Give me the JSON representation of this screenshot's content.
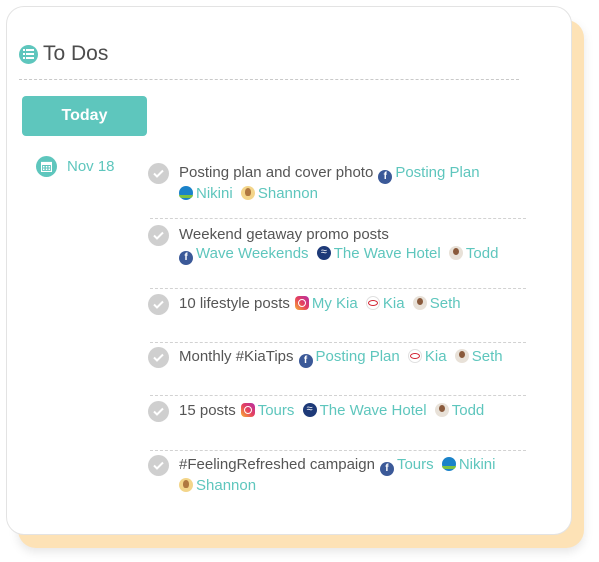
{
  "header": {
    "title": "To Dos",
    "icon": "list-icon"
  },
  "today_button": "Today",
  "date_group": {
    "icon": "calendar-icon",
    "label": "Nov 18"
  },
  "todos": [
    {
      "title": "Posting plan and cover photo",
      "tags": [
        {
          "icon": "facebook-icon",
          "label": "Posting Plan"
        },
        {
          "icon": "nikini-logo-icon",
          "label": "Nikini"
        },
        {
          "icon": "avatar-shannon-icon",
          "label": "Shannon"
        }
      ]
    },
    {
      "title": "Weekend getaway promo posts",
      "tags": [
        {
          "icon": "facebook-icon",
          "label": "Wave Weekends"
        },
        {
          "icon": "wave-hotel-logo-icon",
          "label": "The Wave Hotel"
        },
        {
          "icon": "avatar-todd-icon",
          "label": "Todd"
        }
      ]
    },
    {
      "title": "10 lifestyle posts",
      "tags": [
        {
          "icon": "instagram-icon",
          "label": "My Kia"
        },
        {
          "icon": "kia-logo-icon",
          "label": "Kia"
        },
        {
          "icon": "avatar-seth-icon",
          "label": "Seth"
        }
      ]
    },
    {
      "title": "Monthly #KiaTips",
      "tags": [
        {
          "icon": "facebook-icon",
          "label": "Posting Plan"
        },
        {
          "icon": "kia-logo-icon",
          "label": "Kia"
        },
        {
          "icon": "avatar-seth-icon",
          "label": "Seth"
        }
      ]
    },
    {
      "title": "15 posts",
      "tags": [
        {
          "icon": "instagram-icon",
          "label": "Tours"
        },
        {
          "icon": "wave-hotel-logo-icon",
          "label": "The Wave Hotel"
        },
        {
          "icon": "avatar-todd-icon",
          "label": "Todd"
        }
      ]
    },
    {
      "title": "#FeelingRefreshed campaign",
      "tags": [
        {
          "icon": "facebook-icon",
          "label": "Tours"
        },
        {
          "icon": "nikini-logo-icon",
          "label": "Nikini"
        },
        {
          "icon": "avatar-shannon-icon",
          "label": "Shannon"
        }
      ]
    }
  ],
  "colors": {
    "accent": "#5ec6bd",
    "check": "#cfcfcf",
    "backcard": "#fde2b6",
    "text": "#555555"
  }
}
